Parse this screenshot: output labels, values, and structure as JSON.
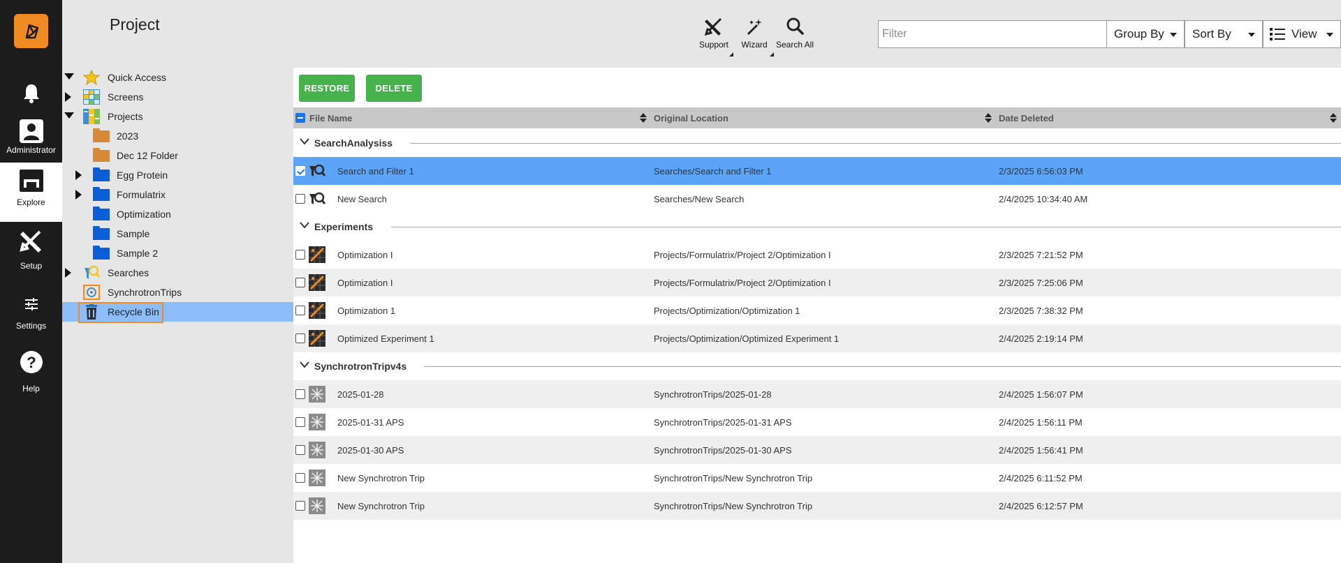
{
  "nav": {
    "items": [
      {
        "label": ""
      },
      {
        "label": "Administrator"
      },
      {
        "label": "Explore"
      },
      {
        "label": "Setup"
      },
      {
        "label": "Settings"
      },
      {
        "label": "Help"
      }
    ]
  },
  "header": {
    "title": "Project",
    "tools": [
      {
        "label": "Support",
        "icon": "tools-icon"
      },
      {
        "label": "Wizard",
        "icon": "magic-wand-icon"
      },
      {
        "label": "Search All",
        "icon": "search-icon"
      }
    ],
    "filter": {
      "placeholder": "Filter",
      "value": ""
    },
    "group_by": "Group By",
    "sort_by": "Sort By",
    "view": "View"
  },
  "tree": {
    "items": [
      {
        "label": "Quick Access"
      },
      {
        "label": "Screens"
      },
      {
        "label": "Projects"
      },
      {
        "label": "2023"
      },
      {
        "label": "Dec 12 Folder"
      },
      {
        "label": "Egg Protein"
      },
      {
        "label": "Formulatrix"
      },
      {
        "label": "Optimization"
      },
      {
        "label": "Sample"
      },
      {
        "label": "Sample 2"
      },
      {
        "label": "Searches"
      },
      {
        "label": "SynchrotronTrips"
      },
      {
        "label": "Recycle Bin"
      }
    ]
  },
  "actions": {
    "restore": "RESTORE",
    "delete": "DELETE"
  },
  "columns": {
    "file_name": "File Name",
    "original_location": "Original Location",
    "date_deleted": "Date Deleted"
  },
  "groups": [
    {
      "name": "SearchAnalysiss",
      "rows": [
        {
          "name": "Search and Filter 1",
          "location": "Searches/Search and Filter 1",
          "date": "2/3/2025 6:56:03 PM",
          "checked": true
        },
        {
          "name": "New Search",
          "location": "Searches/New Search",
          "date": "2/4/2025 10:34:40 AM",
          "checked": false
        }
      ]
    },
    {
      "name": "Experiments",
      "rows": [
        {
          "name": "Optimization I",
          "location": "Projects/Formulatrix/Project 2/Optimization I",
          "date": "2/3/2025 7:21:52 PM",
          "checked": false
        },
        {
          "name": "Optimization I",
          "location": "Projects/Formulatrix/Project 2/Optimization I",
          "date": "2/3/2025 7:25:06 PM",
          "checked": false
        },
        {
          "name": "Optimization 1",
          "location": "Projects/Optimization/Optimization 1",
          "date": "2/3/2025 7:38:32 PM",
          "checked": false
        },
        {
          "name": "Optimized Experiment 1",
          "location": "Projects/Optimization/Optimized Experiment 1",
          "date": "2/4/2025 2:19:14 PM",
          "checked": false
        }
      ]
    },
    {
      "name": "SynchrotronTripv4s",
      "rows": [
        {
          "name": "2025-01-28",
          "location": "SynchrotronTrips/2025-01-28",
          "date": "2/4/2025 1:56:07 PM",
          "checked": false
        },
        {
          "name": "2025-01-31 APS",
          "location": "SynchrotronTrips/2025-01-31 APS",
          "date": "2/4/2025 1:56:11 PM",
          "checked": false
        },
        {
          "name": "2025-01-30 APS",
          "location": "SynchrotronTrips/2025-01-30 APS",
          "date": "2/4/2025 1:56:41 PM",
          "checked": false
        },
        {
          "name": "New Synchrotron Trip",
          "location": "SynchrotronTrips/New Synchrotron Trip",
          "date": "2/4/2025 6:11:52 PM",
          "checked": false
        },
        {
          "name": "New Synchrotron Trip",
          "location": "SynchrotronTrips/New Synchrotron Trip",
          "date": "2/4/2025 6:12:57 PM",
          "checked": false
        }
      ]
    }
  ],
  "colors": {
    "accent": "#f08a23",
    "selected_row": "#5ba4f8",
    "selected_tree": "#8cbdf8",
    "action_green": "#46b24c"
  }
}
